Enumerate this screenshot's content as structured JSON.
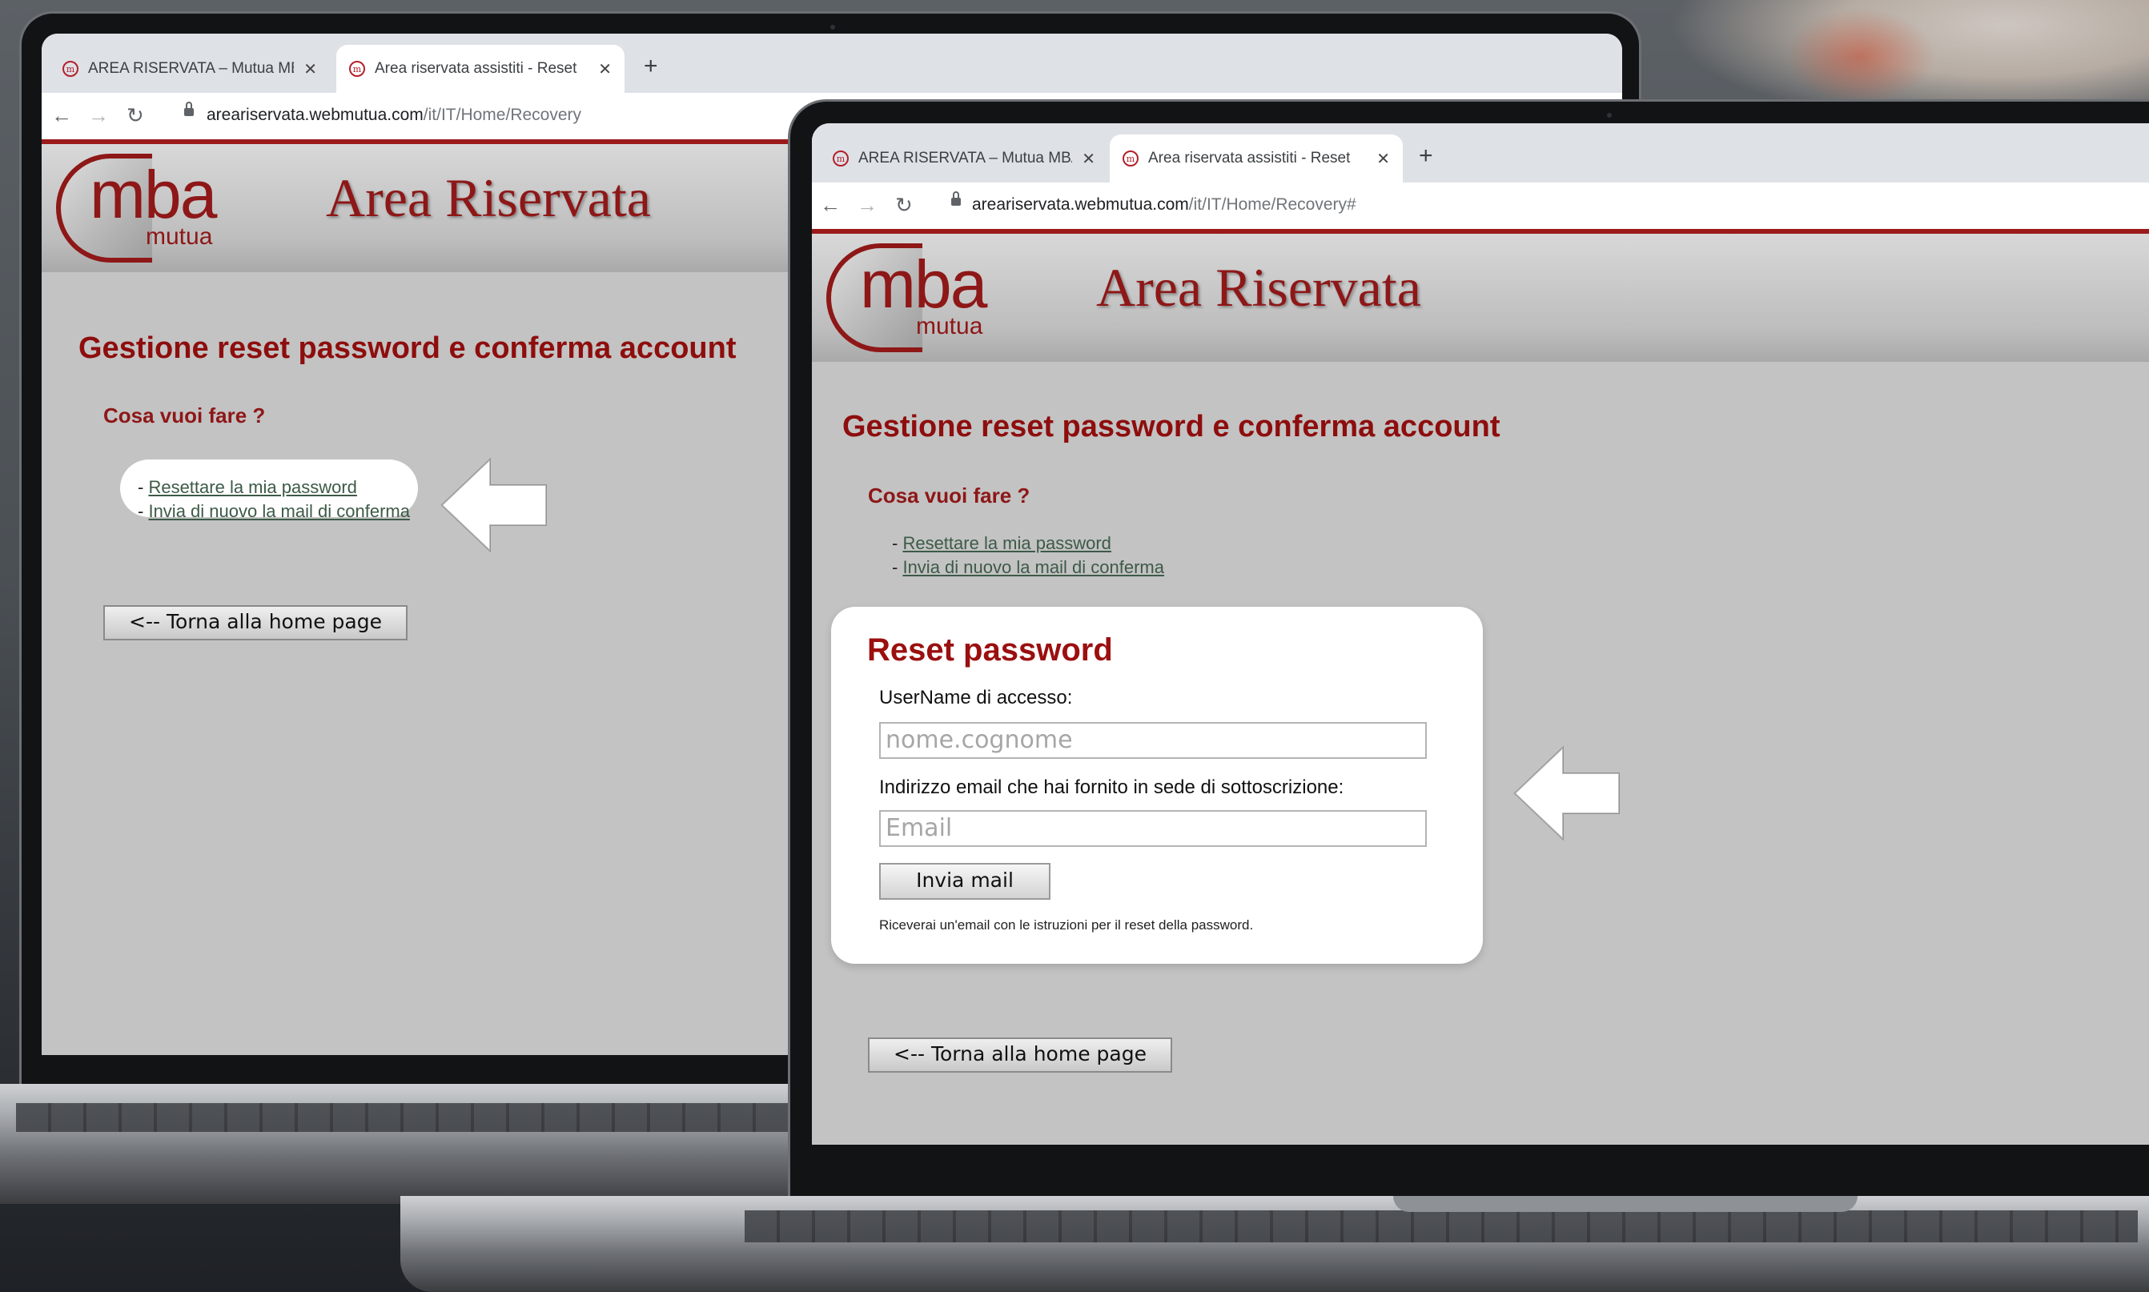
{
  "browser": {
    "tabs": [
      {
        "title": "AREA RISERVATA – Mutua MBA",
        "favicon": "mutua-logo-icon",
        "active": false
      },
      {
        "title": "Area riservata assistiti - Reset",
        "favicon": "mba-logo-icon",
        "active": true
      }
    ],
    "url_back": {
      "domain": "areariservata.webmutua.com",
      "path": "/it/IT/Home/Recovery"
    },
    "url_front": {
      "domain": "areariservata.webmutua.com",
      "path": "/it/IT/Home/Recovery#"
    }
  },
  "site": {
    "logo_text": "mba",
    "logo_sub": "mutua",
    "header_title": "Area Riservata"
  },
  "recovery": {
    "heading": "Gestione reset password e conferma account",
    "question": "Cosa vuoi fare ?",
    "options": [
      {
        "prefix": "- ",
        "label": "Resettare la mia password"
      },
      {
        "prefix": "- ",
        "label": "Invia di nuovo la mail di conferma"
      }
    ],
    "home_button": "<-- Torna alla home page"
  },
  "reset_form": {
    "title": "Reset password",
    "username_label": "UserName di accesso:",
    "username_placeholder": "nome.cognome",
    "email_label": "Indirizzo email che hai fornito in sede di sottoscrizione:",
    "email_placeholder": "Email",
    "submit_label": "Invia mail",
    "note": "Riceverai un'email con le istruzioni per il reset della password."
  },
  "colors": {
    "brand_red": "#8e1717",
    "page_bg": "#c3c3c3",
    "link": "#3d5a47"
  }
}
